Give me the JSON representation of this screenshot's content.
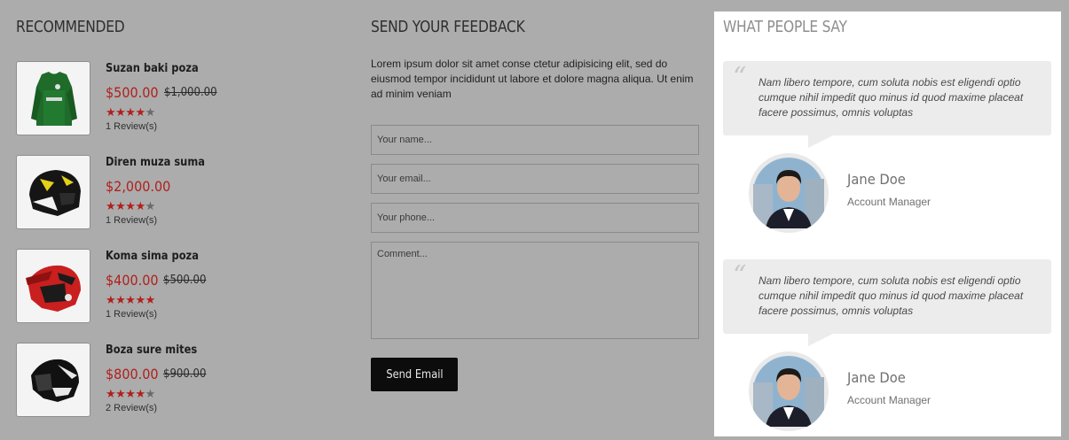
{
  "recommended": {
    "title": "RECOMMENDED",
    "products": [
      {
        "name": "Suzan baki poza",
        "price": "$500.00",
        "old_price": "$1,000.00",
        "rating": 4,
        "reviews": "1 Review(s)",
        "icon": "green-jersey"
      },
      {
        "name": "Diren muza suma",
        "price": "$2,000.00",
        "old_price": "",
        "rating": 4,
        "reviews": "1 Review(s)",
        "icon": "black-yellow-helmet"
      },
      {
        "name": "Koma sima poza",
        "price": "$400.00",
        "old_price": "$500.00",
        "rating": 5,
        "reviews": "1 Review(s)",
        "icon": "red-motocross-helmet"
      },
      {
        "name": "Boza sure mites",
        "price": "$800.00",
        "old_price": "$900.00",
        "rating": 4,
        "reviews": "2 Review(s)",
        "icon": "black-white-helmet"
      }
    ]
  },
  "feedback": {
    "title": "SEND YOUR FEEDBACK",
    "intro": "Lorem ipsum dolor sit amet conse ctetur adipisicing elit, sed do eiusmod tempor incididunt ut labore et dolore magna aliqua. Ut enim ad minim veniam",
    "name_placeholder": "Your name...",
    "email_placeholder": "Your email...",
    "phone_placeholder": "Your phone...",
    "comment_placeholder": "Comment...",
    "send_label": "Send Email"
  },
  "testimonials": {
    "title": "WHAT PEOPLE SAY",
    "items": [
      {
        "quote_mark": "“",
        "quote": "Nam libero tempore, cum soluta nobis est eligendi optio cumque nihil impedit quo minus id quod maxime placeat facere possimus, omnis voluptas",
        "name": "Jane Doe",
        "role": "Account Manager"
      },
      {
        "quote_mark": "“",
        "quote": "Nam libero tempore, cum soluta nobis est eligendi optio cumque nihil impedit quo minus id quod maxime placeat facere possimus, omnis voluptas",
        "name": "Jane Doe",
        "role": "Account Manager"
      }
    ]
  },
  "colors": {
    "background": "#acacac",
    "price_red": "#b0201c",
    "button_black": "#0c0c0c",
    "panel_white": "#ffffff"
  }
}
